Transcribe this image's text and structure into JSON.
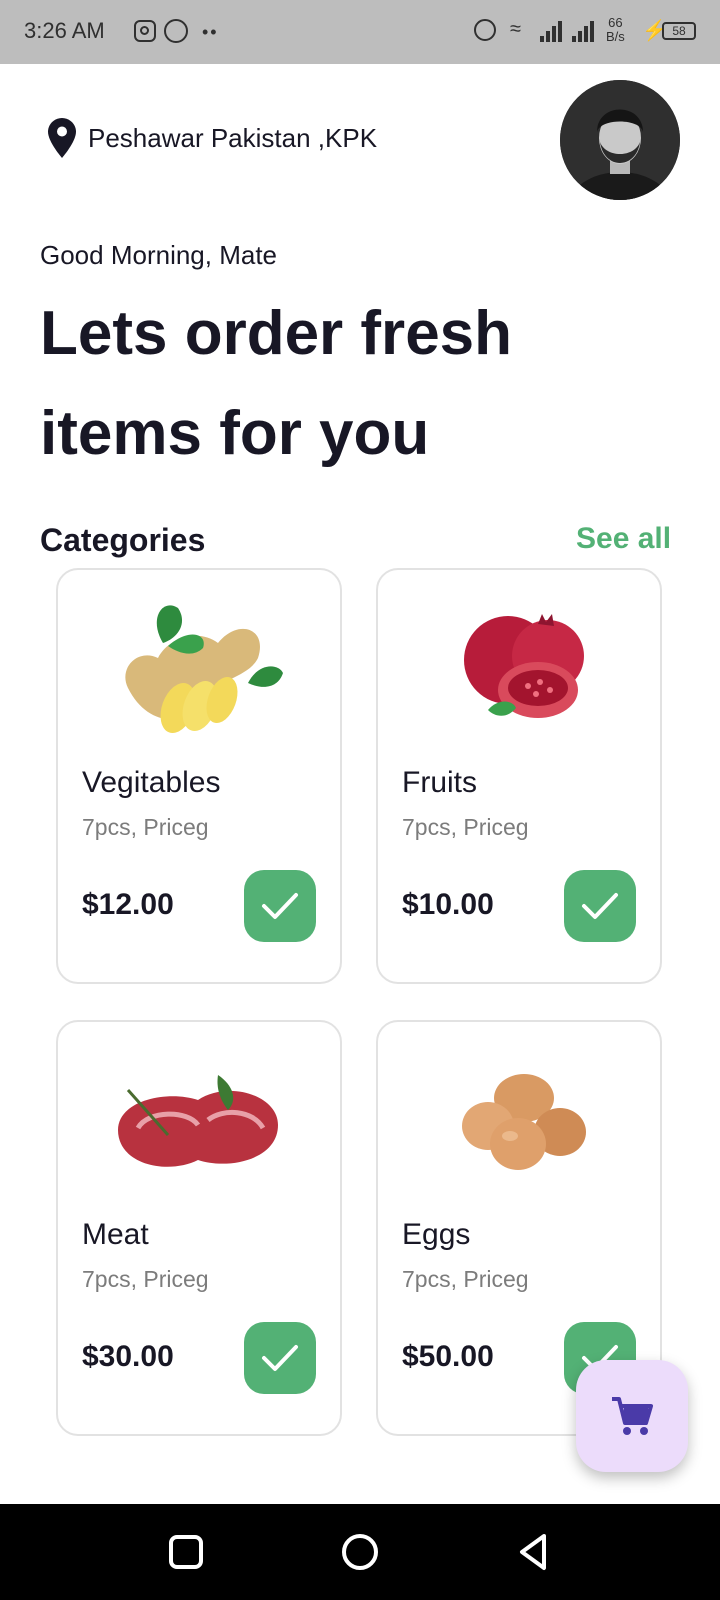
{
  "status_bar": {
    "time": "3:26 AM",
    "dots": "••",
    "net_speed_value": "66",
    "net_speed_unit": "B/s",
    "battery": "58"
  },
  "header": {
    "location": "Peshawar Pakistan ,KPK",
    "greeting": "Good Morning, Mate",
    "headline_line1": "Lets order fresh",
    "headline_line2": "items for you"
  },
  "categories": {
    "title": "Categories",
    "see_all": "See all",
    "items": [
      {
        "name": "Vegitables",
        "subtitle": "7pcs, Priceg",
        "price": "$12.00",
        "image": "ginger-image"
      },
      {
        "name": "Fruits",
        "subtitle": "7pcs, Priceg",
        "price": "$10.00",
        "image": "pomegranate-image"
      },
      {
        "name": "Meat",
        "subtitle": "7pcs, Priceg",
        "price": "$30.00",
        "image": "meat-image"
      },
      {
        "name": "Eggs",
        "subtitle": "7pcs, Priceg",
        "price": "$50.00",
        "image": "eggs-image"
      }
    ]
  },
  "fab": {
    "icon": "cart-icon"
  },
  "colors": {
    "accent": "#53b175",
    "text": "#181725",
    "muted": "#7c7c7c",
    "fab_bg": "#ecdcfb",
    "cart": "#4a3aa8"
  }
}
